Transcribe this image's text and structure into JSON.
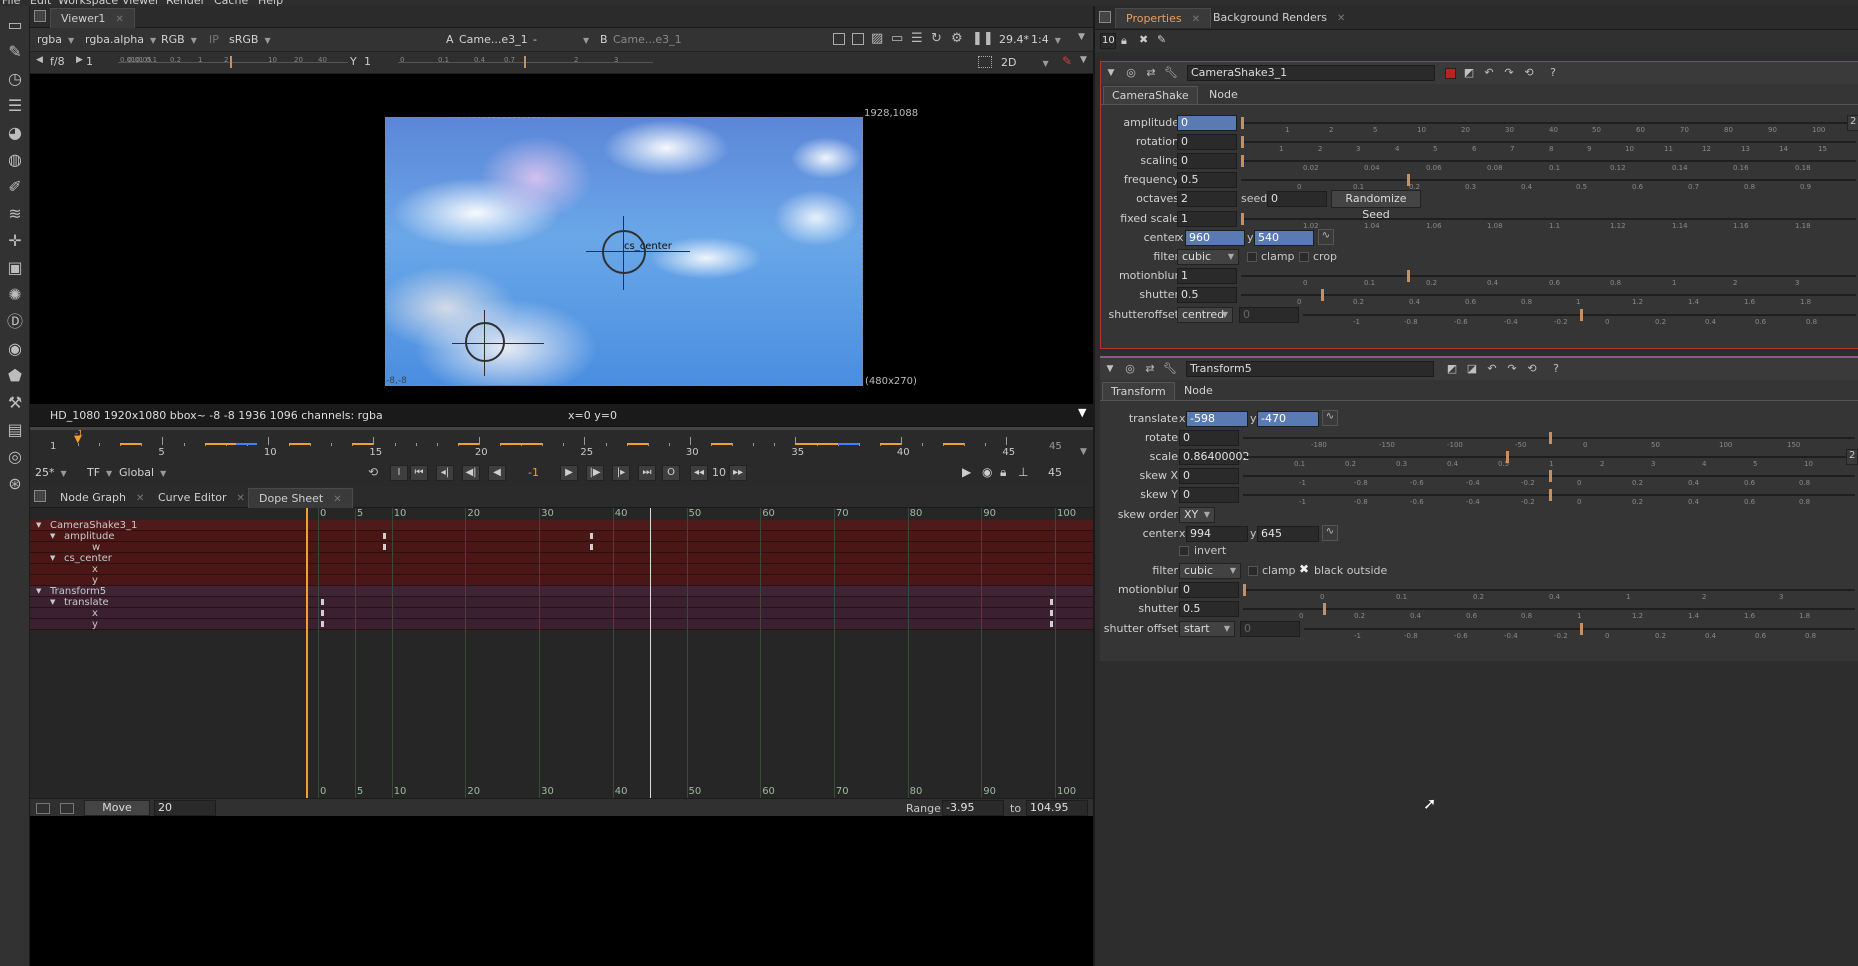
{
  "menubar": [
    "File",
    "Edit",
    "Workspace",
    "Viewer",
    "Render",
    "Cache",
    "Help"
  ],
  "toolbar": [
    "image-icon",
    "draw-icon",
    "time-icon",
    "channel-icon",
    "color-icon",
    "filter-icon",
    "keyer-icon",
    "merge-icon",
    "transform-icon",
    "3d-icon",
    "particles-icon",
    "deep-icon",
    "views-icon",
    "metadata-icon",
    "toolsets-icon",
    "other-icon",
    "furnace-icon",
    "ocula-icon"
  ],
  "viewer": {
    "tab": "Viewer1",
    "channels": "rgba",
    "alpha": "rgba.alpha",
    "display": "RGB",
    "ip": "IP",
    "lut": "sRGB",
    "a_label": "A",
    "a_value": "Came...e3_1",
    "dash": "-",
    "b_label": "B",
    "b_value": "Came...e3_1",
    "fps_display": "29.4*",
    "proxy": "1:4",
    "fstop": "f/8",
    "frame_field": "1",
    "y_label": "Y",
    "y_value": "1",
    "view_mode": "2D",
    "format_corner": "1928,1088",
    "proxy_size": "(480x270)",
    "corner_label": "-8,-8",
    "cs_label": "cs_center",
    "info": "HD_1080 1920x1080  bbox~ -8 -8 1936 1096 channels: rgba",
    "coords": "x=0 y=0",
    "ruler_ticks": [
      "0.01",
      "0.01",
      "0.05",
      "0.1",
      "0.2",
      "1",
      "2",
      "10",
      "20",
      "40"
    ],
    "ruler2_ticks": [
      "0",
      "0.1",
      "0.4",
      "0.7",
      "2",
      "3"
    ]
  },
  "timeline": {
    "start": "1",
    "end": "45",
    "current": "1",
    "ticks": [
      "5",
      "10",
      "15",
      "20",
      "25",
      "30",
      "35",
      "40",
      "45"
    ],
    "fps": "25*",
    "tf": "TF",
    "global": "Global",
    "frame_display": "-1",
    "step": "10",
    "end_field": "45"
  },
  "bottom_tabs": [
    "Node Graph",
    "Curve Editor",
    "Dope Sheet"
  ],
  "dopesheet": {
    "rows": [
      {
        "label": "CameraShake3_1",
        "indent": 0,
        "arrow": true
      },
      {
        "label": "amplitude",
        "indent": 1,
        "arrow": true
      },
      {
        "label": "w",
        "indent": 3,
        "arrow": false
      },
      {
        "label": "cs_center",
        "indent": 1,
        "arrow": true
      },
      {
        "label": "x",
        "indent": 3,
        "arrow": false
      },
      {
        "label": "y",
        "indent": 3,
        "arrow": false
      },
      {
        "label": "Transform5",
        "indent": 0,
        "arrow": true
      },
      {
        "label": "translate",
        "indent": 1,
        "arrow": true
      },
      {
        "label": "x",
        "indent": 3,
        "arrow": false
      },
      {
        "label": "y",
        "indent": 3,
        "arrow": false
      }
    ],
    "grid_numbers": [
      "0",
      "5",
      "10",
      "20",
      "30",
      "40",
      "50",
      "60",
      "70",
      "80",
      "90",
      "100"
    ],
    "grid_numbers_bottom": [
      "0",
      "5",
      "10",
      "20",
      "30",
      "40",
      "50",
      "60",
      "70",
      "80",
      "90",
      "100"
    ]
  },
  "status": {
    "move_label": "Move",
    "move_value": "20",
    "range_label": "Range",
    "range_from": "-3.95",
    "to_label": "to",
    "range_to": "104.95"
  },
  "props": {
    "tabs": [
      "Properties",
      "Background Renders"
    ],
    "max_panels": "10"
  },
  "camerashake": {
    "name": "CameraShake3_1",
    "tabs": [
      "CameraShake",
      "Node"
    ],
    "amplitude_label": "amplitude",
    "amplitude": "0",
    "rotation_label": "rotation",
    "rotation": "0",
    "scaling_label": "scaling",
    "scaling": "0",
    "frequency_label": "frequency",
    "frequency": "0.5",
    "octaves_label": "octaves",
    "octaves": "2",
    "seed_label": "seed",
    "seed": "0",
    "randomize_label": "Randomize Seed",
    "fixedscale_label": "fixed scale",
    "fixedscale": "1",
    "center_label": "center",
    "center_x_label": "x",
    "center_x": "960",
    "center_y_label": "y",
    "center_y": "540",
    "filter_label": "filter",
    "filter": "cubic",
    "clamp_label": "clamp",
    "crop_label": "crop",
    "motionblur_label": "motionblur",
    "motionblur": "1",
    "shutter_label": "shutter",
    "shutter": "0.5",
    "shutteroffset_label": "shutteroffset",
    "shutteroffset": "centred",
    "shutteroffset_value": "0",
    "amp_side_value": "2",
    "amp_ticks": [
      "1",
      "2",
      "5",
      "10",
      "20",
      "30",
      "40",
      "50",
      "60",
      "70",
      "80",
      "90",
      "100"
    ],
    "rot_ticks": [
      "1",
      "2",
      "3",
      "4",
      "5",
      "6",
      "7",
      "8",
      "9",
      "10",
      "11",
      "12",
      "13",
      "14",
      "15"
    ],
    "scale_ticks": [
      "0.02",
      "0.04",
      "0.06",
      "0.08",
      "0.1",
      "0.12",
      "0.14",
      "0.16",
      "0.18"
    ],
    "freq_ticks": [
      "0",
      "0.1",
      "0.2",
      "0.3",
      "0.4",
      "0.5",
      "0.6",
      "0.7",
      "0.8",
      "0.9"
    ],
    "fixed_ticks": [
      "1.02",
      "1.04",
      "1.06",
      "1.08",
      "1.1",
      "1.12",
      "1.14",
      "1.16",
      "1.18"
    ],
    "mb_ticks": [
      "0",
      "0.1",
      "0.2",
      "0.4",
      "0.6",
      "0.8",
      "1",
      "2",
      "3"
    ],
    "shutter_ticks": [
      "0",
      "0.2",
      "0.4",
      "0.6",
      "0.8",
      "1",
      "1.2",
      "1.4",
      "1.6",
      "1.8"
    ],
    "so_ticks": [
      "-1",
      "-0.8",
      "-0.6",
      "-0.4",
      "-0.2",
      "0",
      "0.2",
      "0.4",
      "0.6",
      "0.8"
    ]
  },
  "transform": {
    "name": "Transform5",
    "tabs": [
      "Transform",
      "Node"
    ],
    "translate_label": "translate",
    "translate_x_label": "x",
    "translate_x": "-598",
    "translate_y_label": "y",
    "translate_y": "-470",
    "rotate_label": "rotate",
    "rotate": "0",
    "scale_label": "scale",
    "scale": "0.86400002",
    "skewx_label": "skew X",
    "skewx": "0",
    "skewy_label": "skew Y",
    "skewy": "0",
    "skeworder_label": "skew order",
    "skeworder": "XY",
    "center_label": "center",
    "center_x_label": "x",
    "center_x": "994",
    "center_y_label": "y",
    "center_y": "645",
    "invert_label": "invert",
    "filter_label": "filter",
    "filter": "cubic",
    "clamp_label": "clamp",
    "blackoutside_label": "black outside",
    "motionblur_label": "motionblur",
    "motionblur": "0",
    "shutter_label": "shutter",
    "shutter": "0.5",
    "shutteroffset_label": "shutter offset",
    "shutteroffset": "start",
    "shutteroffset_value": "0",
    "scale_side_value": "2",
    "rot_ticks": [
      "-180",
      "-150",
      "-100",
      "-50",
      "0",
      "50",
      "100",
      "150"
    ],
    "scale_ticks": [
      "0.1",
      "0.2",
      "0.3",
      "0.4",
      "0.5",
      "1",
      "2",
      "3",
      "4",
      "5",
      "10"
    ],
    "skew_ticks": [
      "-1",
      "-0.8",
      "-0.6",
      "-0.4",
      "-0.2",
      "0",
      "0.2",
      "0.4",
      "0.6",
      "0.8"
    ],
    "mb_ticks": [
      "0",
      "0.1",
      "0.2",
      "0.4",
      "1",
      "2",
      "3"
    ],
    "shutter_ticks": [
      "0",
      "0.2",
      "0.4",
      "0.6",
      "0.8",
      "1",
      "1.2",
      "1.4",
      "1.6",
      "1.8"
    ],
    "so_ticks": [
      "-1",
      "-0.8",
      "-0.6",
      "-0.4",
      "-0.2",
      "0",
      "0.2",
      "0.4",
      "0.6",
      "0.8"
    ]
  },
  "colors": {
    "selected_field": "#5a7ab4",
    "timeline_orange": "#f0a030",
    "ds_camerashake_bg": "#4a1616",
    "ds_transform_bg": "#3a2030",
    "panel_red_border": "#c03030"
  }
}
